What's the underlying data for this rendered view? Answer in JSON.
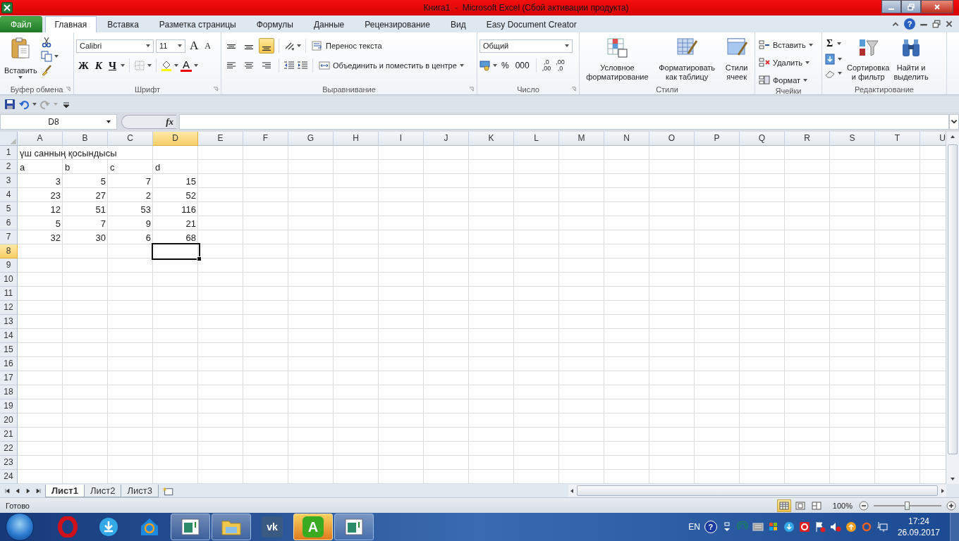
{
  "window": {
    "title": "Книга1  -  Microsoft Excel (Сбой активации продукта)"
  },
  "tabs": [
    {
      "label": "Файл",
      "kind": "file",
      "selected": false
    },
    {
      "label": "Главная",
      "kind": "tab",
      "selected": true
    },
    {
      "label": "Вставка",
      "kind": "tab",
      "selected": false
    },
    {
      "label": "Разметка страницы",
      "kind": "tab",
      "selected": false
    },
    {
      "label": "Формулы",
      "kind": "tab",
      "selected": false
    },
    {
      "label": "Данные",
      "kind": "tab",
      "selected": false
    },
    {
      "label": "Рецензирование",
      "kind": "tab",
      "selected": false
    },
    {
      "label": "Вид",
      "kind": "tab",
      "selected": false
    },
    {
      "label": "Easy Document Creator",
      "kind": "tab",
      "selected": false
    }
  ],
  "ribbon_help": "?",
  "ribbon": {
    "clipboard": {
      "label": "Буфер обмена",
      "paste": "Вставить"
    },
    "font": {
      "label": "Шрифт",
      "font_name": "Calibri",
      "font_size": "11",
      "grow": "A",
      "shrink": "A",
      "bold": "Ж",
      "italic": "К",
      "underline": "Ч",
      "font_color": "A"
    },
    "alignment": {
      "label": "Выравнивание",
      "vertical": [
        {
          "selected": false
        },
        {
          "selected": false
        },
        {
          "selected": true
        }
      ],
      "wrap": "Перенос текста",
      "merge": "Объединить и поместить в центре"
    },
    "number": {
      "label": "Число",
      "format": "Общий",
      "percent": "%",
      "thousands": "000",
      "decimals": [
        {
          "top": ",0",
          "bottom": ",00"
        },
        {
          "top": ",00",
          "bottom": ",0"
        }
      ]
    },
    "styles": {
      "label": "Стили",
      "buttons": [
        {
          "lines": [
            "Условное",
            "форматирование"
          ]
        },
        {
          "lines": [
            "Форматировать",
            "как таблицу"
          ]
        },
        {
          "lines": [
            "Стили",
            "ячеек"
          ]
        }
      ]
    },
    "cells": {
      "label": "Ячейки",
      "buttons": [
        "Вставить",
        "Удалить",
        "Формат"
      ]
    },
    "editing": {
      "label": "Редактирование",
      "sigma": "Σ",
      "sort": [
        "Сортировка",
        "и фильтр"
      ],
      "find": [
        "Найти и",
        "выделить"
      ]
    }
  },
  "name_box": "D8",
  "fx_label": "fx",
  "columns": [
    {
      "label": "A",
      "selected": false
    },
    {
      "label": "B",
      "selected": false
    },
    {
      "label": "C",
      "selected": false
    },
    {
      "label": "D",
      "selected": true
    },
    {
      "label": "E",
      "selected": false
    },
    {
      "label": "F",
      "selected": false
    },
    {
      "label": "G",
      "selected": false
    },
    {
      "label": "H",
      "selected": false
    },
    {
      "label": "I",
      "selected": false
    },
    {
      "label": "J",
      "selected": false
    },
    {
      "label": "K",
      "selected": false
    },
    {
      "label": "L",
      "selected": false
    },
    {
      "label": "M",
      "selected": false
    },
    {
      "label": "N",
      "selected": false
    },
    {
      "label": "O",
      "selected": false
    },
    {
      "label": "P",
      "selected": false
    },
    {
      "label": "Q",
      "selected": false
    },
    {
      "label": "R",
      "selected": false
    },
    {
      "label": "S",
      "selected": false
    },
    {
      "label": "T",
      "selected": false
    },
    {
      "label": "U",
      "selected": false
    }
  ],
  "rows": [
    {
      "number": "1",
      "selected": false,
      "cells": [
        {
          "text": "үш санның қосындысы",
          "kind": "text"
        }
      ]
    },
    {
      "number": "2",
      "selected": false,
      "cells": [
        {
          "text": "a",
          "kind": "text"
        },
        {
          "text": "b",
          "kind": "text"
        },
        {
          "text": "c",
          "kind": "text"
        },
        {
          "text": "d",
          "kind": "text"
        }
      ]
    },
    {
      "number": "3",
      "selected": false,
      "cells": [
        {
          "text": "3",
          "kind": "number"
        },
        {
          "text": "5",
          "kind": "number"
        },
        {
          "text": "7",
          "kind": "number"
        },
        {
          "text": "15",
          "kind": "number"
        }
      ]
    },
    {
      "number": "4",
      "selected": false,
      "cells": [
        {
          "text": "23",
          "kind": "number"
        },
        {
          "text": "27",
          "kind": "number"
        },
        {
          "text": "2",
          "kind": "number"
        },
        {
          "text": "52",
          "kind": "number"
        }
      ]
    },
    {
      "number": "5",
      "selected": false,
      "cells": [
        {
          "text": "12",
          "kind": "number"
        },
        {
          "text": "51",
          "kind": "number"
        },
        {
          "text": "53",
          "kind": "number"
        },
        {
          "text": "116",
          "kind": "number"
        }
      ]
    },
    {
      "number": "6",
      "selected": false,
      "cells": [
        {
          "text": "5",
          "kind": "number"
        },
        {
          "text": "7",
          "kind": "number"
        },
        {
          "text": "9",
          "kind": "number"
        },
        {
          "text": "21",
          "kind": "number"
        }
      ]
    },
    {
      "number": "7",
      "selected": false,
      "cells": [
        {
          "text": "32",
          "kind": "number"
        },
        {
          "text": "30",
          "kind": "number"
        },
        {
          "text": "6",
          "kind": "number"
        },
        {
          "text": "68",
          "kind": "number"
        }
      ]
    },
    {
      "number": "8",
      "selected": true
    },
    {
      "number": "9",
      "selected": false
    },
    {
      "number": "10",
      "selected": false
    },
    {
      "number": "11",
      "selected": false
    },
    {
      "number": "12",
      "selected": false
    },
    {
      "number": "13",
      "selected": false
    },
    {
      "number": "14",
      "selected": false
    },
    {
      "number": "15",
      "selected": false
    },
    {
      "number": "16",
      "selected": false
    },
    {
      "number": "17",
      "selected": false
    },
    {
      "number": "18",
      "selected": false
    },
    {
      "number": "19",
      "selected": false
    },
    {
      "number": "20",
      "selected": false
    },
    {
      "number": "21",
      "selected": false
    },
    {
      "number": "22",
      "selected": false
    },
    {
      "number": "23",
      "selected": false
    },
    {
      "number": "24",
      "selected": false
    }
  ],
  "sheets": [
    {
      "label": "Лист1",
      "selected": true
    },
    {
      "label": "Лист2",
      "selected": false
    },
    {
      "label": "Лист3",
      "selected": false
    }
  ],
  "status": {
    "text": "Готово",
    "views": [
      {
        "selected": true
      },
      {
        "selected": false
      },
      {
        "selected": false
      }
    ],
    "zoom": "100%",
    "zoom_slider": {
      "level": 0.5
    }
  },
  "taskbar": {
    "apps": [
      {
        "kind": "opera",
        "running": false,
        "flashing": false
      },
      {
        "kind": "download",
        "running": false,
        "flashing": false
      },
      {
        "kind": "mail",
        "running": false,
        "flashing": false
      },
      {
        "kind": "window",
        "running": true,
        "flashing": false
      },
      {
        "kind": "explorer",
        "running": true,
        "flashing": false
      },
      {
        "kind": "vk",
        "label": "vk",
        "running": false,
        "flashing": false
      },
      {
        "kind": "letter",
        "label": "A",
        "running": true,
        "flashing": true
      },
      {
        "kind": "window",
        "running": true,
        "flashing": false
      }
    ],
    "tray": {
      "lang": "EN",
      "help": "?",
      "time": "17:24",
      "date": "26.09.2017"
    }
  }
}
